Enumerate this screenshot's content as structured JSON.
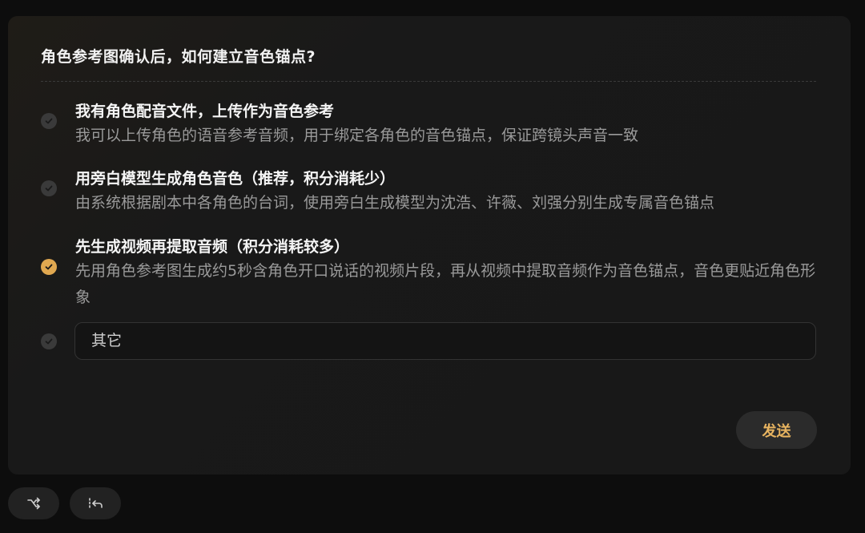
{
  "question": "角色参考图确认后，如何建立音色锚点?",
  "options": [
    {
      "title": "我有角色配音文件，上传作为音色参考",
      "desc": "我可以上传角色的语音参考音频，用于绑定各角色的音色锚点，保证跨镜头声音一致",
      "selected": false
    },
    {
      "title": "用旁白模型生成角色音色（推荐，积分消耗少）",
      "desc": "由系统根据剧本中各角色的台词，使用旁白生成模型为沈浩、许薇、刘强分别生成专属音色锚点",
      "selected": false
    },
    {
      "title": "先生成视频再提取音频（积分消耗较多）",
      "desc": "先用角色参考图生成约5秒含角色开口说话的视频片段，再从视频中提取音频作为音色锚点，音色更贴近角色形象",
      "selected": true
    }
  ],
  "other": {
    "placeholder": "其它"
  },
  "send_label": "发送",
  "colors": {
    "accent": "#e0a850",
    "send_text": "#e8b460",
    "card_bg": "#181818",
    "check_inactive": "#3a3a3a"
  },
  "icons": {
    "check": "check-icon",
    "shuffle": "shuffle-icon",
    "undo": "undo-icon"
  }
}
